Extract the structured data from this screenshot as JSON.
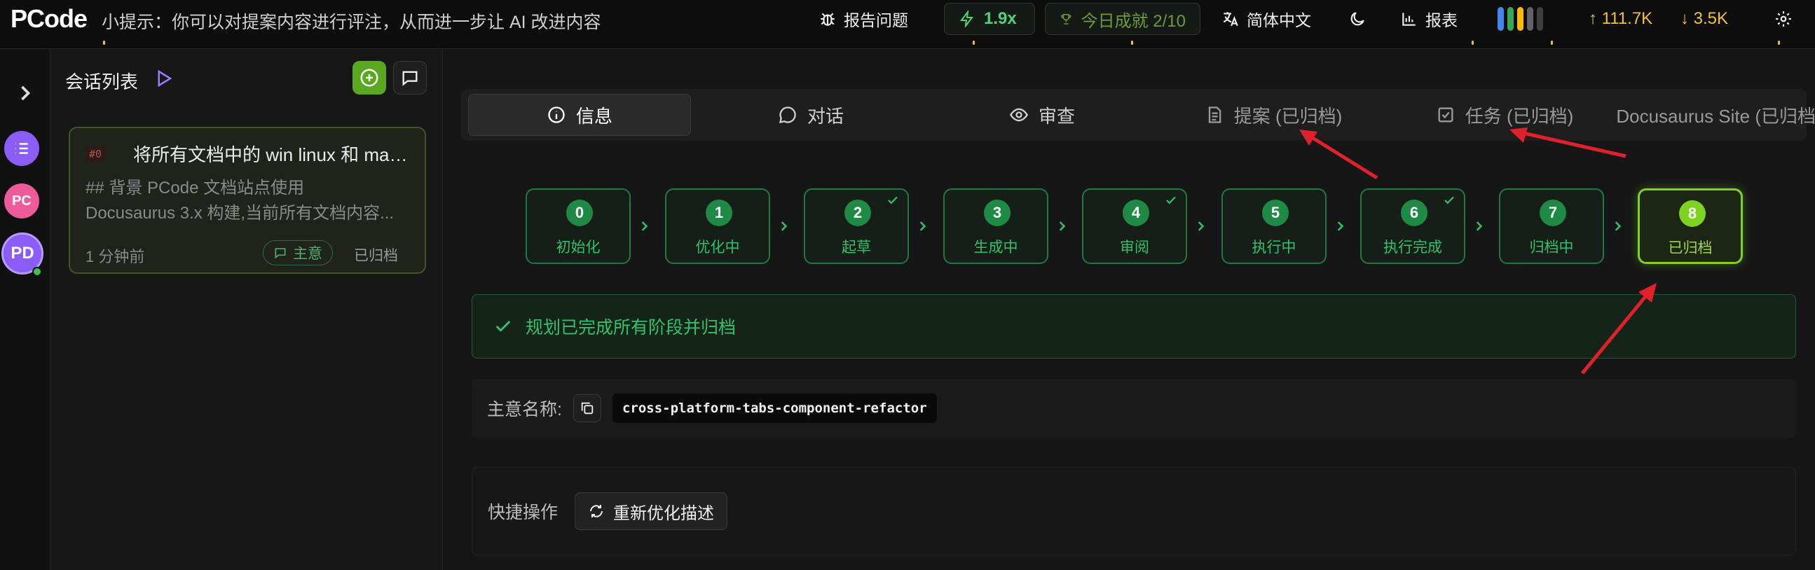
{
  "app": {
    "logo": "PCode",
    "tip": "小提示：你可以对提案内容进行评注，从而进一步让 AI 改进内容"
  },
  "topbar": {
    "report_issue": "报告问题",
    "speed": "1.9x",
    "achievement": "今日成就 2/10",
    "language": "简体中文",
    "reports": "报表",
    "stat_up": "↑ 111.7K",
    "stat_down": "↓ 3.5K"
  },
  "rail": {
    "avatars": [
      {
        "initials": "PC",
        "color": "#ef5a9a"
      },
      {
        "initials": "PD",
        "color": "#8b5cf6"
      }
    ]
  },
  "sidebar": {
    "title": "会话列表",
    "card": {
      "hash": "#0",
      "title": "将所有文档中的 win linux 和 mac...",
      "desc_line1": "## 背景 PCode 文档站点使用",
      "desc_line2": "Docusaurus 3.x 构建,当前所有文档内容...",
      "time": "1 分钟前",
      "tag": "主意",
      "status": "已归档"
    }
  },
  "tabs": [
    {
      "label": "信息",
      "icon": "info-icon"
    },
    {
      "label": "对话",
      "icon": "chat-icon"
    },
    {
      "label": "审查",
      "icon": "eye-icon"
    },
    {
      "label": "提案 (已归档)",
      "icon": "document-icon"
    },
    {
      "label": "任务 (已归档)",
      "icon": "checklist-icon"
    },
    {
      "label": "Docusaurus Site (已归档)",
      "icon": "folder-icon"
    }
  ],
  "steps": [
    {
      "num": "0",
      "label": "初始化"
    },
    {
      "num": "1",
      "label": "优化中"
    },
    {
      "num": "2",
      "label": "起草"
    },
    {
      "num": "3",
      "label": "生成中"
    },
    {
      "num": "4",
      "label": "审阅"
    },
    {
      "num": "5",
      "label": "执行中"
    },
    {
      "num": "6",
      "label": "执行完成"
    },
    {
      "num": "7",
      "label": "归档中"
    },
    {
      "num": "8",
      "label": "已归档"
    }
  ],
  "status_message": "规划已完成所有阶段并归档",
  "idea_name": {
    "label": "主意名称:",
    "value": "cross-platform-tabs-component-refactor"
  },
  "quick_actions": {
    "label": "快捷操作",
    "reoptimize": "重新优化描述"
  },
  "colors": {
    "accent": "#7ed321",
    "step_green": "#1f8a45",
    "annotation_red": "#e0202a"
  }
}
